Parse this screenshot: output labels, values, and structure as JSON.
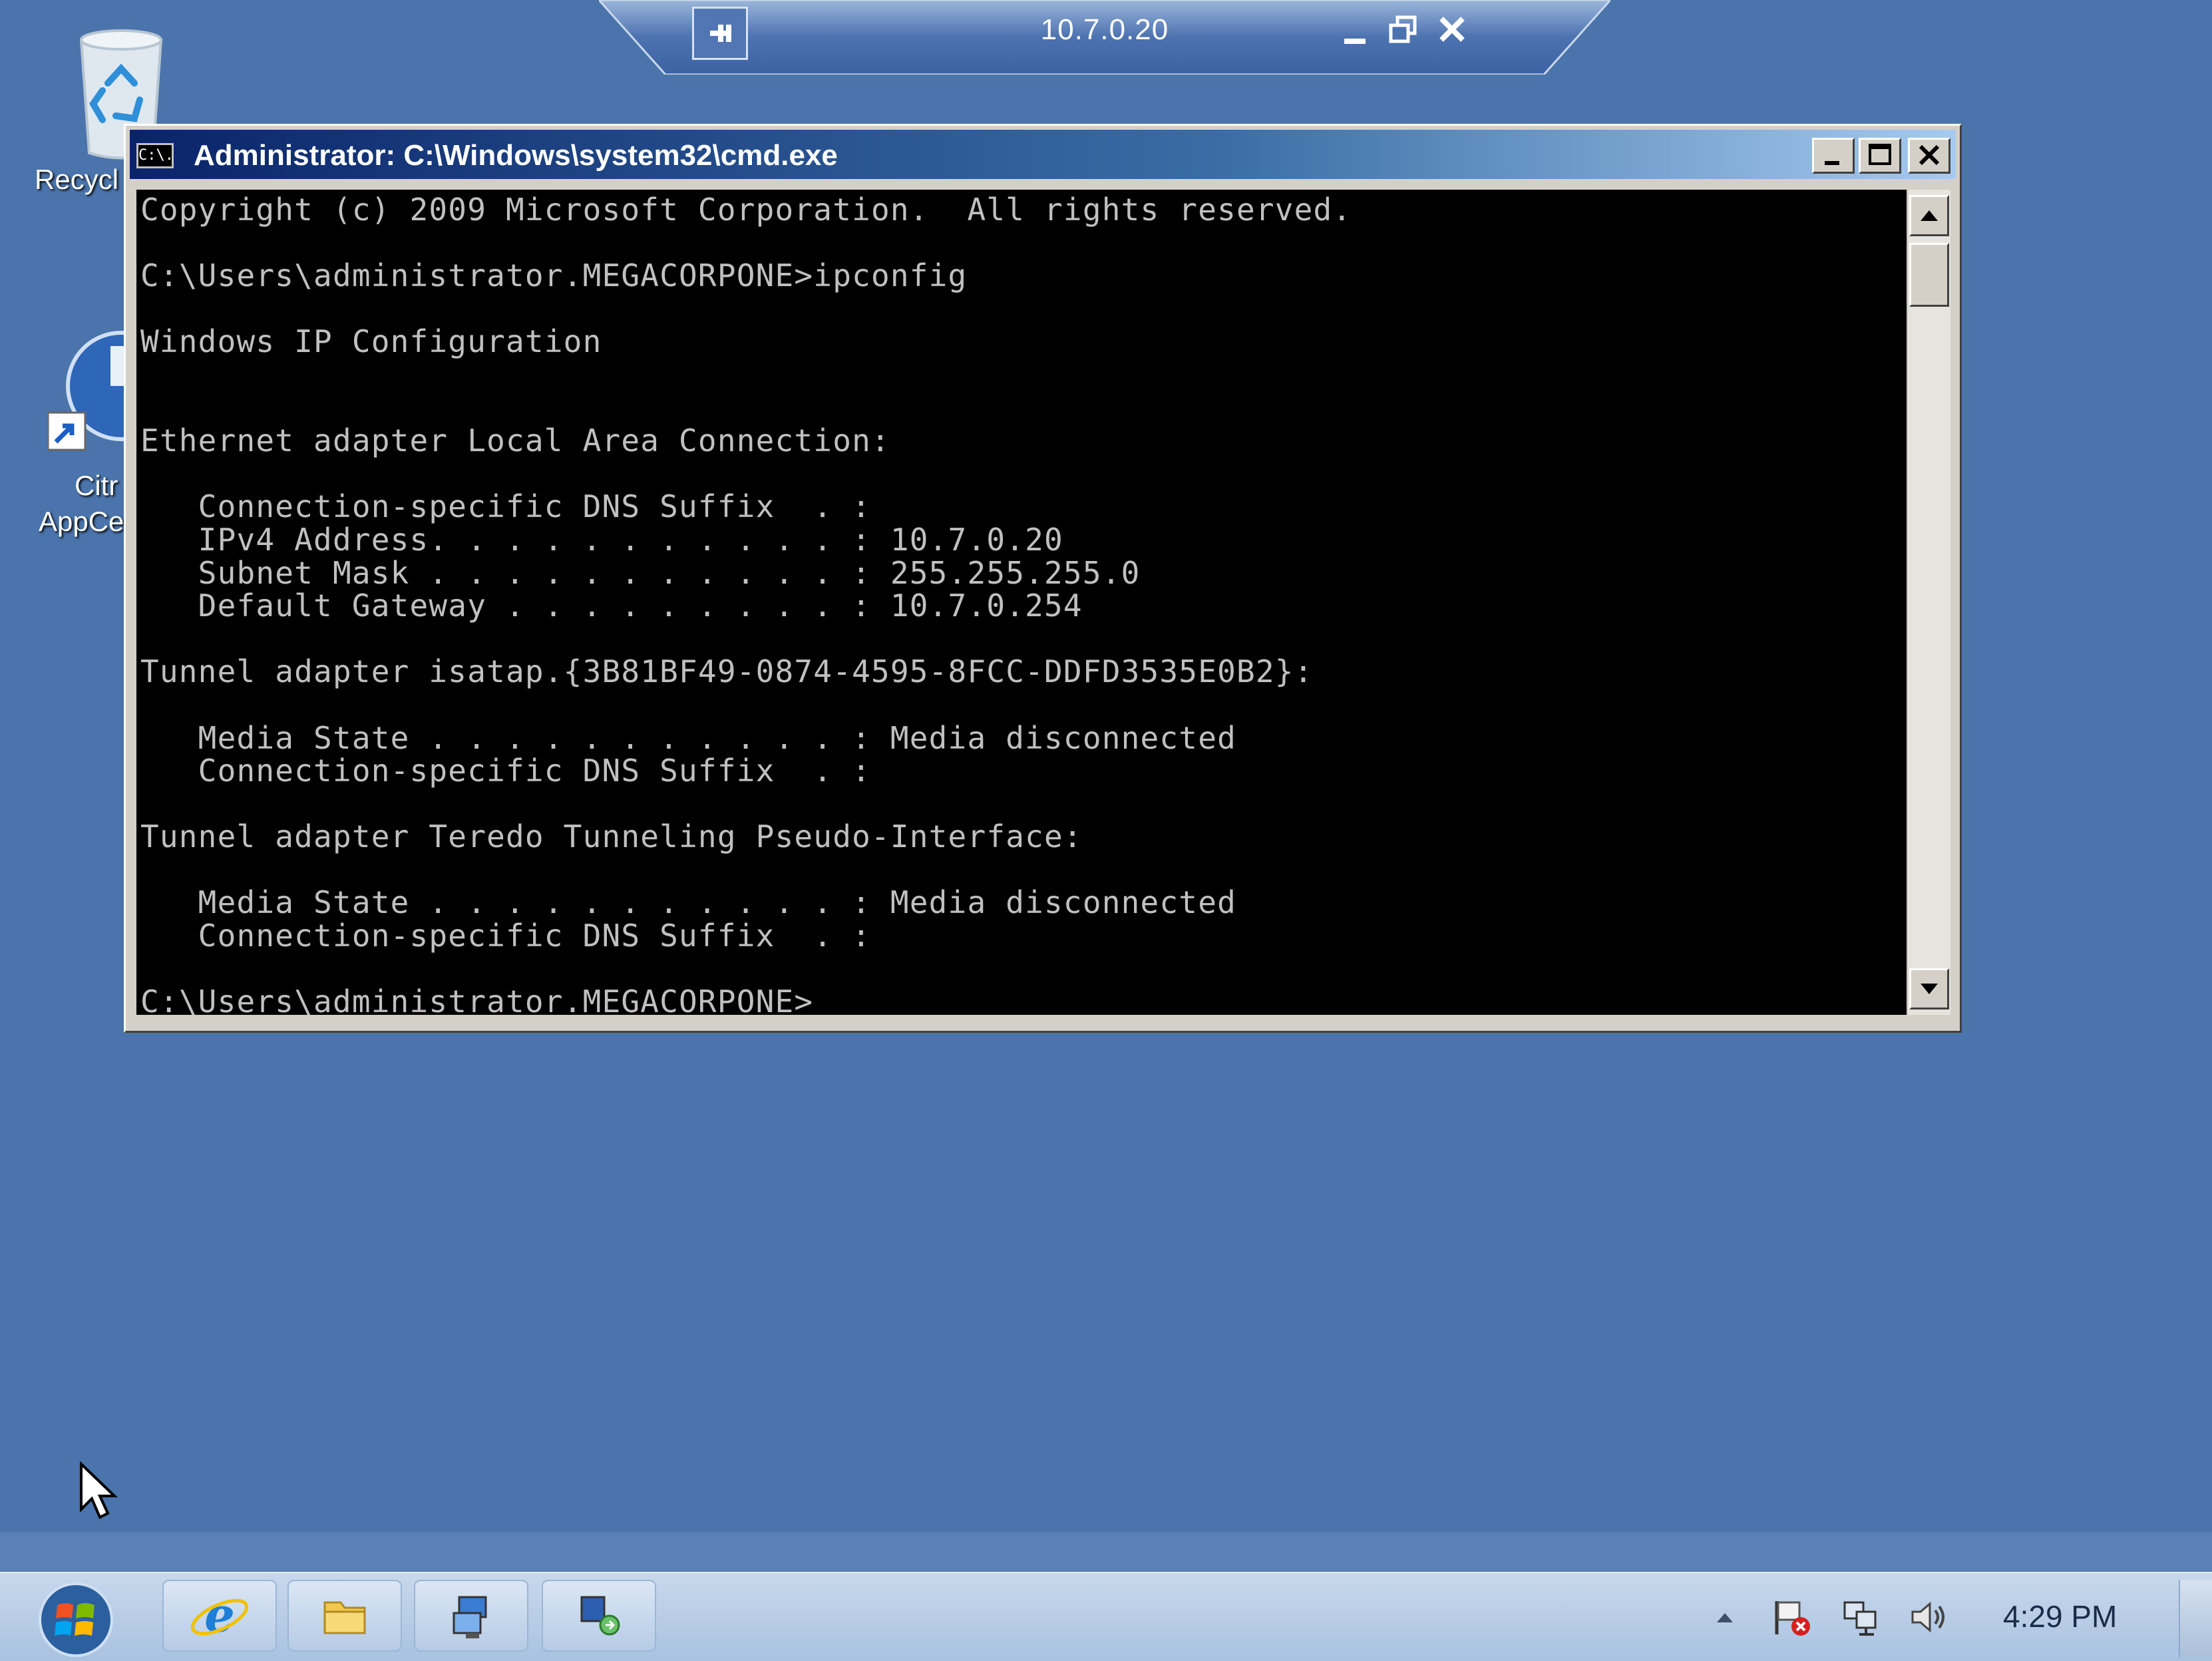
{
  "desktop": {
    "recycle_bin_label": "Recycl",
    "citrix_label_line1": "Citr",
    "citrix_label_line2": "AppCe"
  },
  "rdp_bar": {
    "host": "10.7.0.20"
  },
  "cmd_window": {
    "title": "Administrator: C:\\Windows\\system32\\cmd.exe",
    "icon_text": "C:\\.",
    "console_lines": [
      "Copyright (c) 2009 Microsoft Corporation.  All rights reserved.",
      "",
      "C:\\Users\\administrator.MEGACORPONE>ipconfig",
      "",
      "Windows IP Configuration",
      "",
      "",
      "Ethernet adapter Local Area Connection:",
      "",
      "   Connection-specific DNS Suffix  . :",
      "   IPv4 Address. . . . . . . . . . . : 10.7.0.20",
      "   Subnet Mask . . . . . . . . . . . : 255.255.255.0",
      "   Default Gateway . . . . . . . . . : 10.7.0.254",
      "",
      "Tunnel adapter isatap.{3B81BF49-0874-4595-8FCC-DDFD3535E0B2}:",
      "",
      "   Media State . . . . . . . . . . . : Media disconnected",
      "   Connection-specific DNS Suffix  . :",
      "",
      "Tunnel adapter Teredo Tunneling Pseudo-Interface:",
      "",
      "   Media State . . . . . . . . . . . : Media disconnected",
      "   Connection-specific DNS Suffix  . :",
      "",
      "C:\\Users\\administrator.MEGACORPONE>"
    ]
  },
  "taskbar": {
    "clock": "4:29 PM",
    "buttons": [
      "internet-explorer",
      "windows-explorer",
      "remote-desktop",
      "network-tool"
    ]
  }
}
